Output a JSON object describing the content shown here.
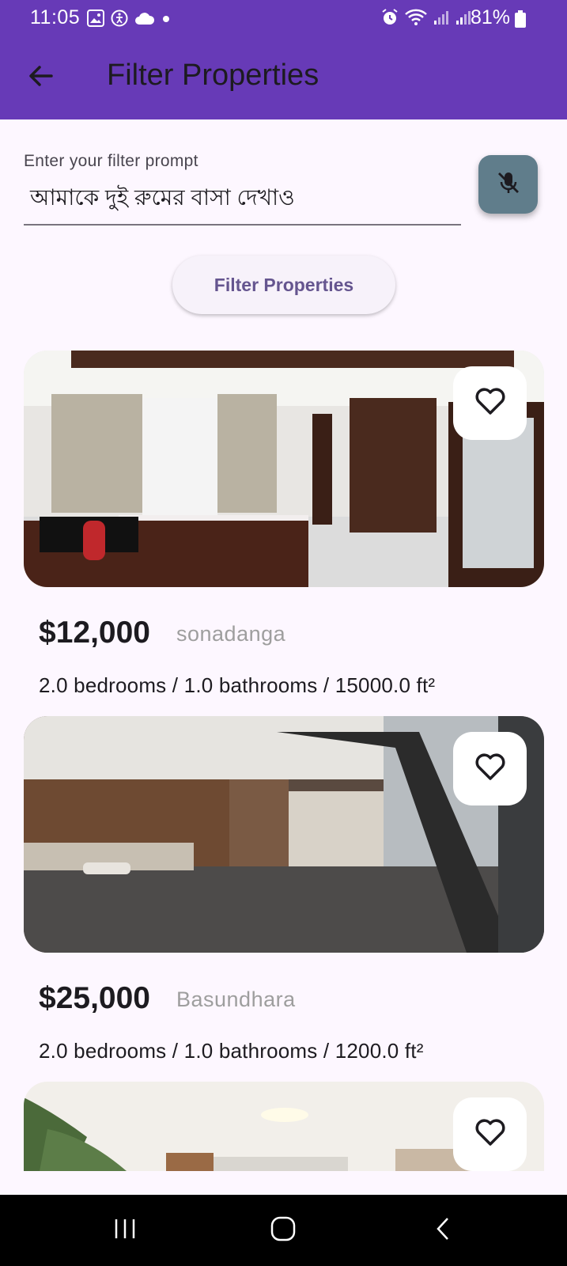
{
  "status_bar": {
    "time": "11:05",
    "battery": "81%",
    "left_icons": [
      "gallery-icon",
      "accessibility-icon",
      "cloud-icon",
      "dot-icon"
    ],
    "right_icons": [
      "alarm-icon",
      "wifi-icon",
      "signal-icon",
      "signal-icon",
      "battery-icon"
    ]
  },
  "app_bar": {
    "title": "Filter Properties",
    "back_icon": "arrow-back-icon",
    "color": "#673ab7"
  },
  "filter": {
    "label": "Enter your filter prompt",
    "value": "আমাকে দুই রুমের বাসা দেখাও",
    "mic_icon": "mic-off-icon",
    "button_label": "Filter Properties"
  },
  "properties": [
    {
      "price": "$12,000",
      "location": "sonadanga",
      "details": "2.0 bedrooms / 1.0 bathrooms / 15000.0 ft²",
      "favorite_icon": "heart-outline-icon"
    },
    {
      "price": "$25,000",
      "location": "Basundhara",
      "details": "2.0 bedrooms / 1.0 bathrooms / 1200.0 ft²",
      "favorite_icon": "heart-outline-icon"
    },
    {
      "favorite_icon": "heart-outline-icon"
    }
  ],
  "nav_bar": {
    "items": [
      "recent-apps-icon",
      "home-icon",
      "back-icon"
    ]
  }
}
